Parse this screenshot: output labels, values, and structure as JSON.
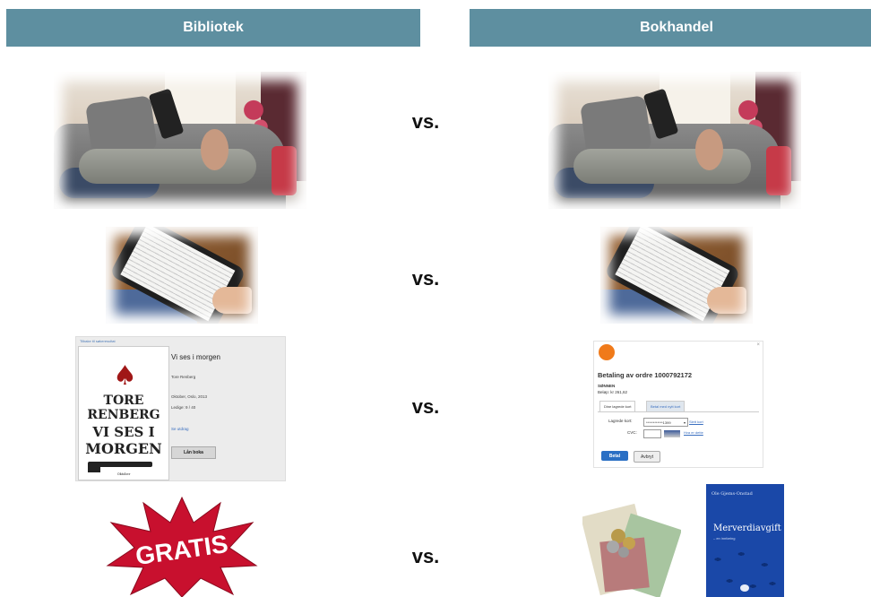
{
  "headers": {
    "left": "Bibliotek",
    "right": "Bokhandel"
  },
  "vs_label": "vs.",
  "library_loan": {
    "top_link": "Tilbake til søkeresultat",
    "cover": {
      "lines": [
        "TORE",
        "RENBERG",
        "VI SES I",
        "MORGEN"
      ],
      "publisher": "Oktober"
    },
    "title": "Vi ses i morgen",
    "author": "Tore Renberg",
    "publication": "Oktober, Oslo, 2013",
    "availability": "Ledige: 9 / 40",
    "excerpt_link": "Se utdrag",
    "loan_button": "Lån boka"
  },
  "payment": {
    "title": "Betaling av ordre 1000792172",
    "product": "SØNNEN",
    "amount": "Beløp: kr 261,62",
    "tabs": [
      "Dine lagrede kort",
      "Betal med nytt kort"
    ],
    "saved_card_label": "Lagrede kort:",
    "saved_card_value": "************1399",
    "delete_link": "Slett kort",
    "cvc_label": "CVC:",
    "cvc_help_link": "Hva er dette",
    "pay_button": "Betal",
    "cancel_button": "Avbryt"
  },
  "gratis_label": "GRATIS",
  "book_cover": {
    "author": "Ole Gjems-Onstad",
    "title": "Merverdiavgift",
    "subtitle": "– en innføring"
  }
}
